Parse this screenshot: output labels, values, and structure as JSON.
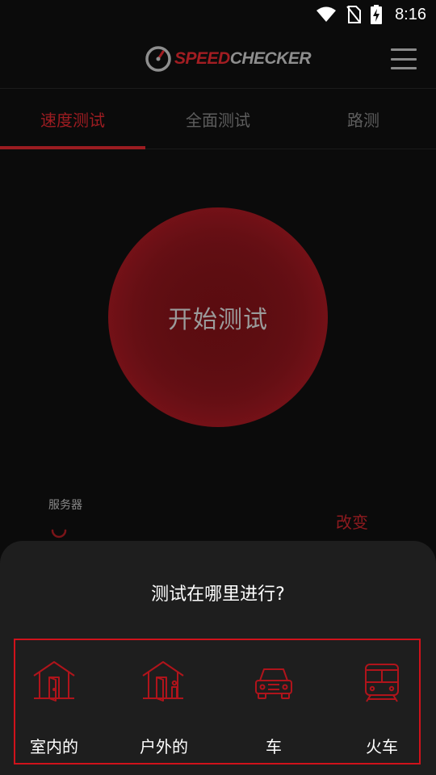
{
  "status_bar": {
    "time": "8:16",
    "icons": [
      "wifi-icon",
      "no-sim-icon",
      "battery-charging-icon"
    ]
  },
  "header": {
    "logo_speed": "SPEED",
    "logo_checker": "CHECKER",
    "menu_icon": "hamburger-menu-icon"
  },
  "tabs": [
    {
      "label": "速度测试",
      "active": true
    },
    {
      "label": "全面测试",
      "active": false
    },
    {
      "label": "路测",
      "active": false
    }
  ],
  "main": {
    "start_label": "开始测试",
    "server_label": "服务器",
    "change_label": "改变"
  },
  "sheet": {
    "title": "测试在哪里进行?",
    "options": [
      {
        "label": "室内的",
        "icon": "indoor-house-icon"
      },
      {
        "label": "户外的",
        "icon": "outdoor-house-icon"
      },
      {
        "label": "车",
        "icon": "car-icon"
      },
      {
        "label": "火车",
        "icon": "train-icon"
      }
    ]
  },
  "colors": {
    "accent": "#9c1c21",
    "highlight_border": "#d0121b",
    "background": "#0b0b0b",
    "sheet": "#1e1e1e"
  }
}
